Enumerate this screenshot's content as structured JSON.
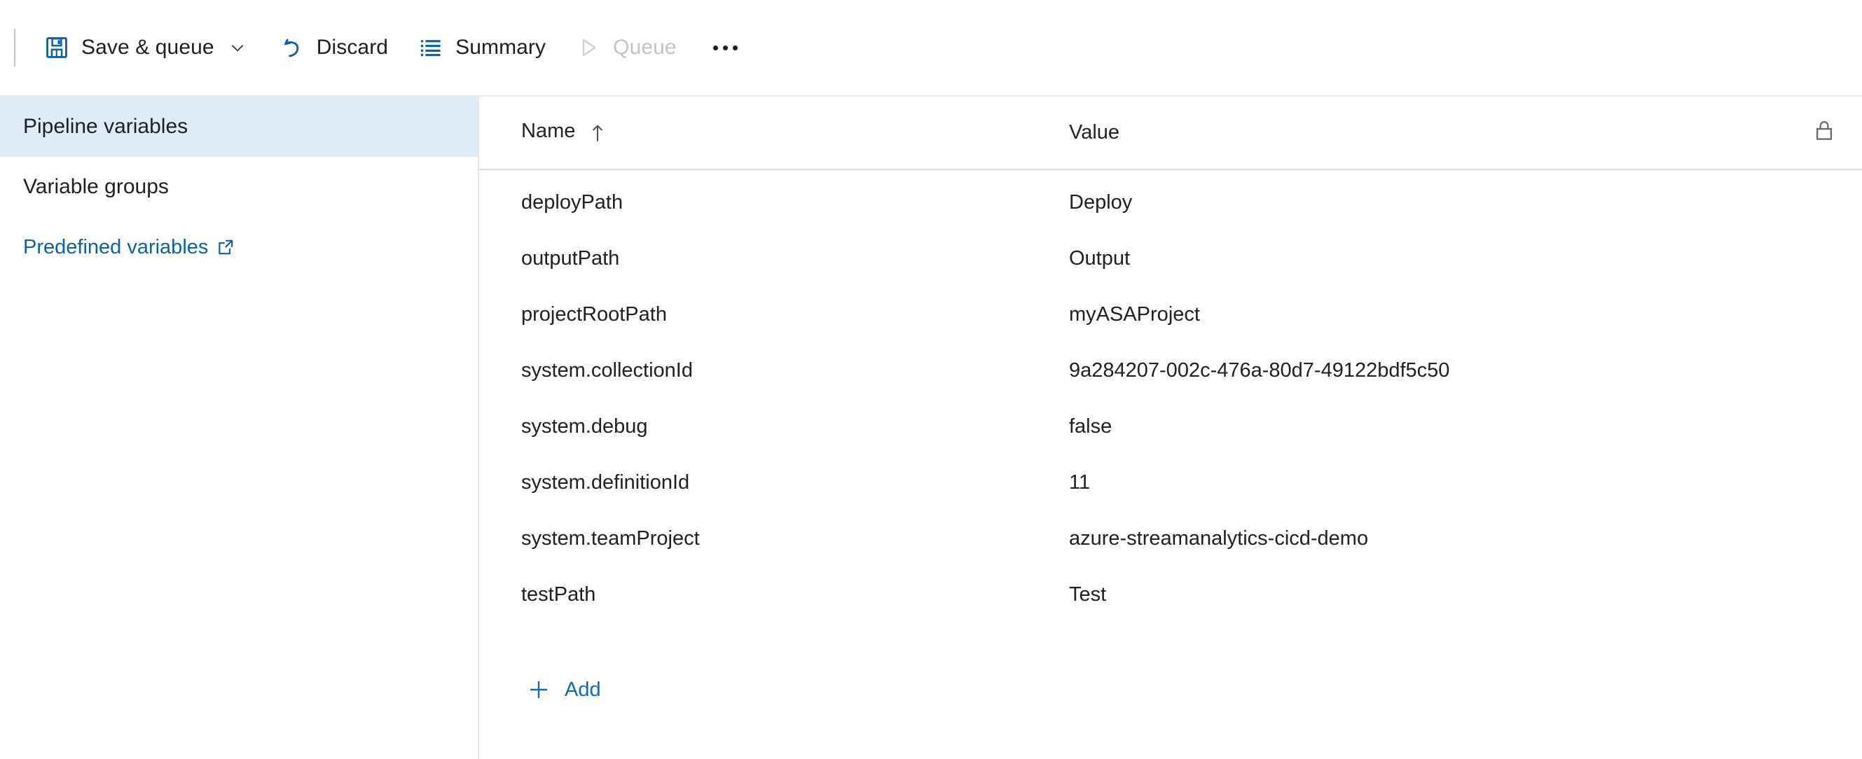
{
  "toolbar": {
    "save_queue_label": "Save & queue",
    "save_icon": "floppy-disk-save-icon",
    "caret_icon": "chevron-down-icon",
    "discard_label": "Discard",
    "discard_icon": "undo-arrow-icon",
    "summary_label": "Summary",
    "summary_icon": "list-lines-icon",
    "queue_label": "Queue",
    "queue_icon": "play-triangle-icon",
    "queue_disabled": true,
    "more_label": "More actions",
    "more_icon": "ellipsis-icon"
  },
  "sidebar": {
    "items": [
      {
        "label": "Pipeline variables",
        "selected": true,
        "external": false
      },
      {
        "label": "Variable groups",
        "selected": false,
        "external": false
      },
      {
        "label": "Predefined variables",
        "selected": false,
        "external": true,
        "external_icon": "external-link-icon"
      }
    ]
  },
  "table": {
    "columns": [
      {
        "label": "Name",
        "sort": "ascending",
        "sort_icon": "sort-ascending-arrow-icon"
      },
      {
        "label": "Value"
      }
    ],
    "lock_icon": "lock-icon",
    "rows": [
      {
        "name": "deployPath",
        "value": "Deploy"
      },
      {
        "name": "outputPath",
        "value": "Output"
      },
      {
        "name": "projectRootPath",
        "value": "myASAProject"
      },
      {
        "name": "system.collectionId",
        "value": "9a284207-002c-476a-80d7-49122bdf5c50"
      },
      {
        "name": "system.debug",
        "value": "false"
      },
      {
        "name": "system.definitionId",
        "value": "11"
      },
      {
        "name": "system.teamProject",
        "value": "azure-streamanalytics-cicd-demo"
      },
      {
        "name": "testPath",
        "value": "Test"
      }
    ],
    "add": {
      "label": "Add",
      "icon": "plus-icon"
    }
  },
  "colors": {
    "accent_blue": "#0b6cb5",
    "selected_row_bg": "#deecf9",
    "text_primary": "#212121",
    "text_disabled": "#c4c4c4"
  }
}
